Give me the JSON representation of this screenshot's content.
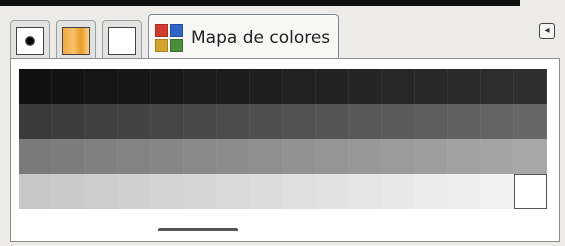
{
  "tabs": [
    {
      "id": "brushes",
      "icon": "brush-icon"
    },
    {
      "id": "patterns",
      "icon": "pattern-icon"
    },
    {
      "id": "fonts",
      "icon": "white-square-icon"
    },
    {
      "id": "colormap",
      "icon": "palette-icon",
      "label": "Mapa de colores"
    }
  ],
  "palette_colors": [
    "#d13b2f",
    "#2f64c8",
    "#d3a22d",
    "#4a8e3d"
  ],
  "menu_icon": "left-arrow-icon",
  "swatches": [
    "#111111",
    "#131313",
    "#151515",
    "#171717",
    "#191919",
    "#1b1b1b",
    "#1d1d1d",
    "#1f1f1f",
    "#212121",
    "#232323",
    "#252525",
    "#272727",
    "#292929",
    "#2b2b2b",
    "#2d2d2d",
    "#2f2f2f",
    "#3a3a3a",
    "#3d3d3d",
    "#404040",
    "#434343",
    "#464646",
    "#494949",
    "#4c4c4c",
    "#4f4f4f",
    "#525252",
    "#555555",
    "#585858",
    "#5b5b5b",
    "#5e5e5e",
    "#616161",
    "#646464",
    "#676767",
    "#7a7a7a",
    "#7d7d7d",
    "#808080",
    "#838383",
    "#868686",
    "#898989",
    "#8c8c8c",
    "#8f8f8f",
    "#929292",
    "#959595",
    "#989898",
    "#9b9b9b",
    "#9e9e9e",
    "#a1a1a1",
    "#a4a4a4",
    "#a7a7a7",
    "#c7c7c7",
    "#cacaca",
    "#cdcdcd",
    "#d0d0d0",
    "#d3d3d3",
    "#d6d6d6",
    "#d9d9d9",
    "#dcdcdc",
    "#dfdfdf",
    "#e2e2e2",
    "#e5e5e5",
    "#e8e8e8",
    "#ebebeb",
    "#eeeeee",
    "#f1f1f1",
    "#ffffff"
  ],
  "selected_index": 63
}
